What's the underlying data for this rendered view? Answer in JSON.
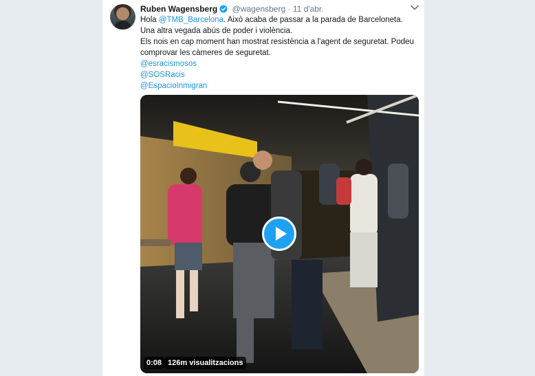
{
  "tweet": {
    "author_name": "Ruben Wagensberg",
    "handle": "@wagensberg",
    "separator": "·",
    "timestamp": "11 d'abr.",
    "verified_icon": "verified-badge-icon",
    "menu_icon": "chevron-down-icon",
    "text": {
      "line1_prefix": "Hola ",
      "line1_mention": "@TMB_Barcelona",
      "line1_suffix": ". Això acaba de passar a la parada de Barceloneta.",
      "line2": "Una altra vegada abús de poder i violència.",
      "line3": "Els nois en cap moment han mostrat resistència a l'agent de seguretat. Podeu",
      "line4": "comprovar les càmeres de seguretat.",
      "mention1": "@esracismosos",
      "mention2": "@SOSRacis",
      "mention3": "@EspacioInmigran"
    },
    "media": {
      "type": "video",
      "play_icon": "play-icon",
      "duration": "0:08",
      "views": "126m visualitzacions"
    }
  },
  "colors": {
    "link": "#1b95e0",
    "verified": "#1da1f2",
    "play_button": "#1da1f2",
    "background": "#e6ecf0"
  }
}
